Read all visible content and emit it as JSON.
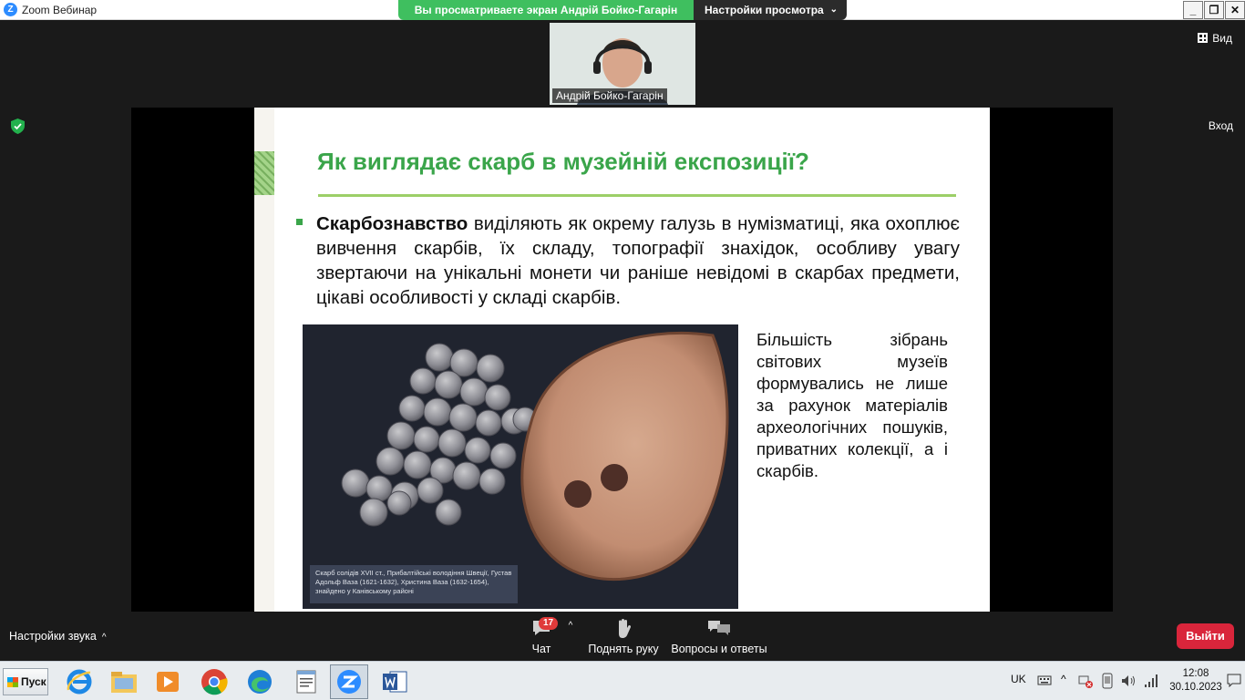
{
  "window": {
    "title": "Zoom Вебинар",
    "controls": {
      "minimize": "_",
      "restore": "❐",
      "close": "✕"
    }
  },
  "share_bar": {
    "viewing_text": "Вы просматриваете экран Андрій Бойко-Гагарін",
    "view_settings_label": "Настройки просмотра"
  },
  "header": {
    "view_label": "Вид",
    "enter_label": "Вход"
  },
  "participant": {
    "name": "Андрій Бойко-Гагарін"
  },
  "slide": {
    "title": "Як виглядає скарб в музейній експозиції?",
    "bullet_bold": "Скарбознавство",
    "bullet_text": " виділяють як окрему галузь в нумізматиці, яка охоплює вивчення скарбів, їх складу, топографії знахідок, особливу увагу звертаючи на унікальні монети чи раніше невідомі в скарбах предмети, цікаві особливості у складі скарбів.",
    "side_text": "Більшість зібрань світових музеїв формувались не лише за рахунок матеріалів археологічних пошуків, приватних колекції, а і скарбів.",
    "photo_caption": "Скарб солідів XVII ст., Прибалтійські володіння Швеції, Густав Адольф Ваза (1621-1632), Христина Ваза (1632-1654), знайдено у Канівському районі"
  },
  "controls": {
    "audio_settings": "Настройки звука",
    "chat_label": "Чат",
    "chat_badge": "17",
    "raise_hand_label": "Поднять руку",
    "qa_label": "Вопросы и ответы",
    "exit_label": "Выйти"
  },
  "taskbar": {
    "start_label": "Пуск",
    "language": "UK",
    "time": "12:08",
    "date": "30.10.2023",
    "apps": [
      "internet-explorer",
      "file-explorer",
      "media-player",
      "chrome",
      "edge",
      "notepad",
      "zoom",
      "word"
    ]
  },
  "colors": {
    "accent_green": "#3aa54a",
    "share_green": "#3fbf5f",
    "exit_red": "#d9253b",
    "zoom_blue": "#2d8cff"
  }
}
